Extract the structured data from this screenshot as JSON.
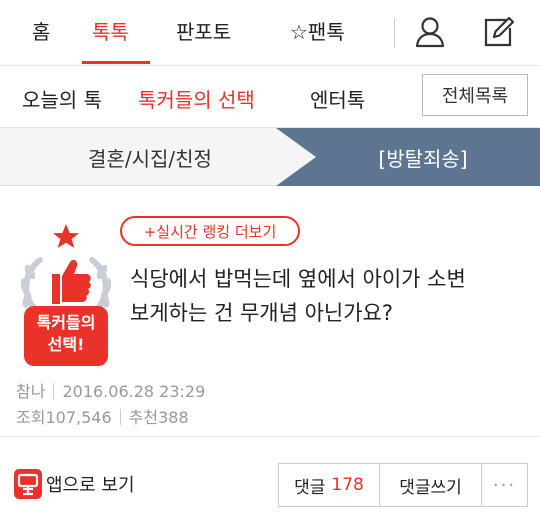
{
  "top_nav": {
    "items": [
      {
        "label": "홈"
      },
      {
        "label": "톡톡"
      },
      {
        "label": "판포토"
      },
      {
        "label": "☆팬톡"
      }
    ],
    "active_index": 1,
    "icons": [
      "user-icon",
      "write-icon"
    ]
  },
  "sub_nav": {
    "items": [
      {
        "label": "오늘의 톡"
      },
      {
        "label": "톡커들의 선택"
      },
      {
        "label": "엔터톡"
      }
    ],
    "active_index": 1,
    "all_list_label": "전체목록"
  },
  "breadcrumb": {
    "category": "결혼/시집/친정",
    "board": "[방탈죄송]"
  },
  "post": {
    "badge_text_line1": "톡커들의",
    "badge_text_line2": "선택!",
    "ranking_button": "+실시간 랭킹 더보기",
    "title_line1": "식당에서 밥먹는데 옆에서 아이가 소변",
    "title_line2": "보게하는 건 무개념 아닌가요?",
    "author": "참나",
    "date": "2016.06.28 23:29",
    "views_label": "조회",
    "views": "107,546",
    "recommend_label": "추천",
    "recommend": "388"
  },
  "actions": {
    "app_label": "앱으로 보기",
    "comments_label": "댓글",
    "comments_count": "178",
    "write_comment_label": "댓글쓰기",
    "more_label": "···"
  },
  "colors": {
    "accent": "#e8322a",
    "band_dark": "#5d7591",
    "band_light": "#f5f5f5"
  }
}
